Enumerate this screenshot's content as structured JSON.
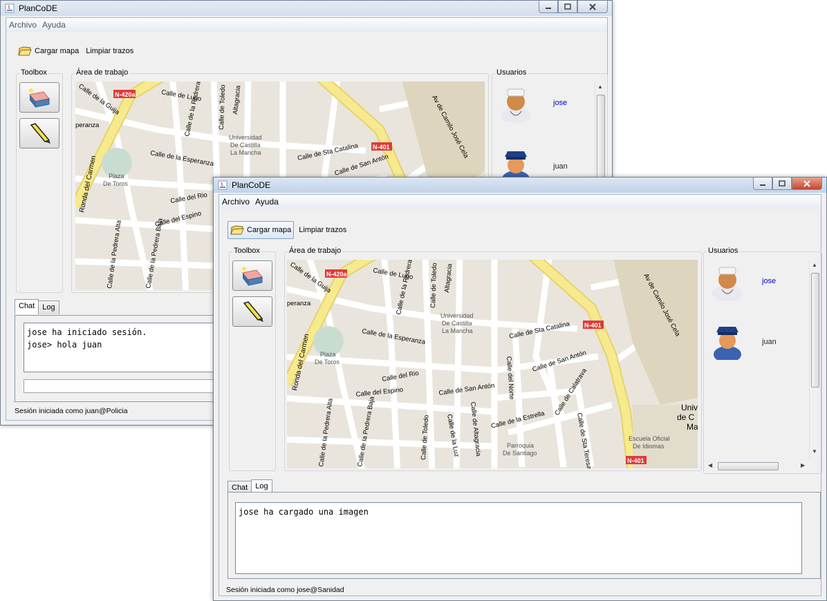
{
  "app_title": "PlanCoDE",
  "menus": [
    "Archivo",
    "Ayuda"
  ],
  "toolbar": {
    "load_map": "Cargar mapa",
    "clear_strokes": "Limpiar trazos"
  },
  "panels": {
    "toolbox": "Toolbox",
    "work_area": "Área de trabajo",
    "users": "Usuarios"
  },
  "users": [
    {
      "name": "jose",
      "role": "doctor",
      "color": "#0000cc"
    },
    {
      "name": "juan",
      "role": "police",
      "color": "#222222"
    }
  ],
  "tabs": [
    "Chat",
    "Log"
  ],
  "map_labels": {
    "n420a": "N-420a",
    "n401": "N-401",
    "ronda_carmen": "Ronda del Carmen",
    "calle_guija": "Calle de la Guija",
    "calle_lugo": "Calle de Lugo",
    "calle_pedrera": "Calle de la Pedrera",
    "calle_toledo": "Calle de Toledo",
    "altagracia": "Altagracia",
    "universidad": [
      "Universidad",
      "De Castilla",
      "La Mancha"
    ],
    "sta_catalina": "Calle de Sta Catalina",
    "esperanza": "Calle de la Esperanza",
    "esperanza_short": "peranza",
    "calle_rio": "Calle del Rio",
    "calle_espino": "Calle del Espino",
    "plaza_toros": [
      "Plaza",
      "De Toros"
    ],
    "pedrera_alta": "Calle de la Pedrera Alta",
    "pedrera_baja": "Calle de la Pedrera Baja",
    "san_anton": "Calle de San Antón",
    "av_camilo": "Av de Camilo José Cela",
    "calle_norte": "Calle del Norte",
    "calle_estrella": "Calle de la Estrella",
    "calle_calatrava": "Calle de Calatrava",
    "calle_toledo2": "Calle de Toledo",
    "calle_luz": "Calle de la Luz",
    "calle_altagracia": "Calle de Altagracia",
    "parroquia": [
      "Parroquia",
      "De Santiago"
    ],
    "escuela": [
      "Escuela Oficial",
      "De Idiomas"
    ],
    "sta_teresa": "Calle de Sta Teresa",
    "univ_cut": [
      "Univ",
      "de C",
      "Ma"
    ]
  },
  "back_window": {
    "chat_lines": [
      "jose ha iniciado sesión.",
      "jose> hola juan"
    ],
    "status": "Sesión iniciada como juan@Policia"
  },
  "front_window": {
    "log_lines": [
      "jose ha cargado una imagen"
    ],
    "status": "Sesión iniciada como jose@Sanidad"
  },
  "colors": {
    "road_main": "#f7e98e",
    "road_main_edge": "#e6d26a",
    "block": "#e9e5dc",
    "road": "#ffffff",
    "park": "#c9dcd0",
    "route_badge": "#e03a3a"
  }
}
